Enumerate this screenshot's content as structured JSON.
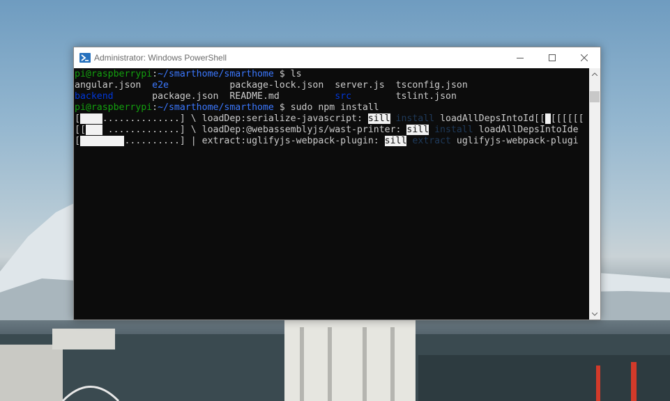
{
  "window": {
    "title": "Administrator: Windows PowerShell"
  },
  "colors": {
    "prompt_user": "#13a10e",
    "prompt_path": "#3b78ff",
    "dir": "#0037da",
    "background": "#0c0c0c",
    "text": "#cccccc"
  },
  "terminal": {
    "line1": {
      "user": "pi@raspberrypi",
      "sep": ":",
      "path": "~/smarthome/smarthome",
      "symbol": " $ ",
      "cmd": "ls"
    },
    "ls_row1": {
      "c1": "angular.json",
      "c2": "e2e",
      "c3": "package-lock.json",
      "c4": "server.js",
      "c5": "tsconfig.json"
    },
    "ls_row2": {
      "c1": "backend",
      "c2": "package.json",
      "c3": "README.md",
      "c4": "src",
      "c5": "tslint.json"
    },
    "line4": {
      "user": "pi@raspberrypi",
      "sep": ":",
      "path": "~/smarthome/smarthome",
      "symbol": " $ ",
      "cmd": "sudo npm install"
    },
    "prog1": {
      "open": "[",
      "fill": "    ",
      "dots": "..............",
      "close": "] \\ ",
      "text": "loadDep:serialize-javascript: ",
      "tag": "sill",
      "verb": " install ",
      "rest": "loadAllDepsIntoId[[",
      "cursor": " ",
      "tail": "[[[[[["
    },
    "prog2": {
      "open": "[[",
      "fill": "   ",
      "dots": " .............",
      "close": "] \\ ",
      "text": "loadDep:@webassemblyjs/wast-printer: ",
      "tag": "sill",
      "verb": " install ",
      "rest": "loadAllDepsIntoIde"
    },
    "prog3": {
      "open": "[",
      "fill": "        ",
      "dots": "..........",
      "close": "] | ",
      "text": "extract:uglifyjs-webpack-plugin: ",
      "tag": "sill",
      "verb": " extract ",
      "rest": "uglifyjs-webpack-plugi"
    }
  },
  "icons": {
    "app": "powershell-icon",
    "minimize": "minimize-icon",
    "maximize": "maximize-icon",
    "close": "close-icon"
  }
}
